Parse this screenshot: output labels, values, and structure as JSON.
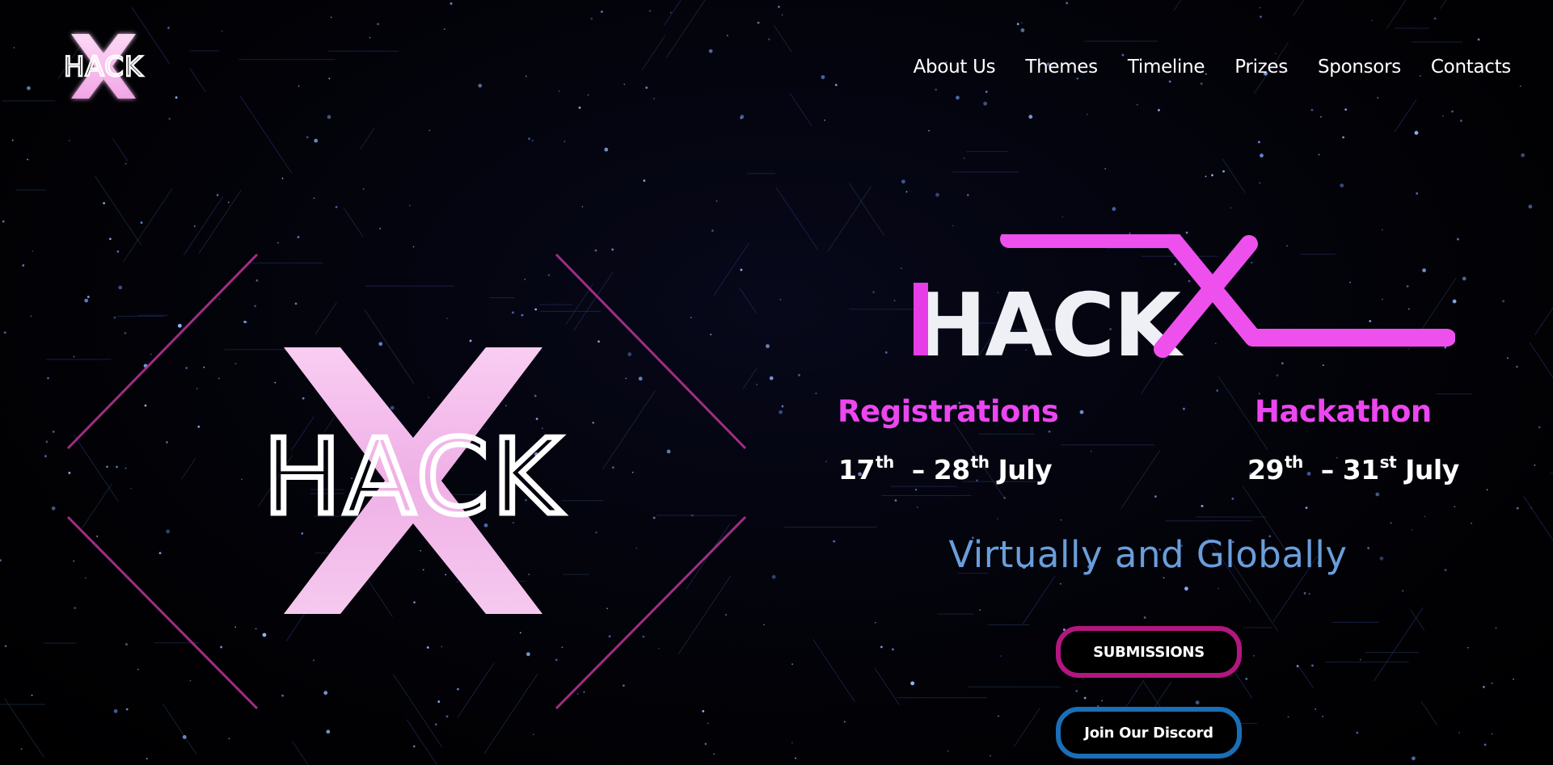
{
  "header": {
    "logo_text": "HACK",
    "nav": [
      {
        "label": "About Us"
      },
      {
        "label": "Themes"
      },
      {
        "label": "Timeline"
      },
      {
        "label": "Prizes"
      },
      {
        "label": "Sponsors"
      },
      {
        "label": "Contacts"
      }
    ]
  },
  "hero": {
    "big_logo_text": "HACK",
    "title_text": "HACK",
    "registrations": {
      "label": "Registrations",
      "start_day": "17",
      "start_suffix": "th",
      "end_day": "28",
      "end_suffix": "th",
      "month": "July"
    },
    "hackathon": {
      "label": "Hackathon",
      "start_day": "29",
      "start_suffix": "th",
      "end_day": "31",
      "end_suffix": "st",
      "month": "July"
    },
    "tagline": "Virtually and Globally",
    "buttons": {
      "submissions": "SUBMISSIONS",
      "discord": "Join Our Discord"
    }
  },
  "colors": {
    "accent_pink": "#ec46f0",
    "tagline_blue": "#6a9edb",
    "submissions_border": "#b3177f",
    "discord_border": "#1a6fb6"
  }
}
